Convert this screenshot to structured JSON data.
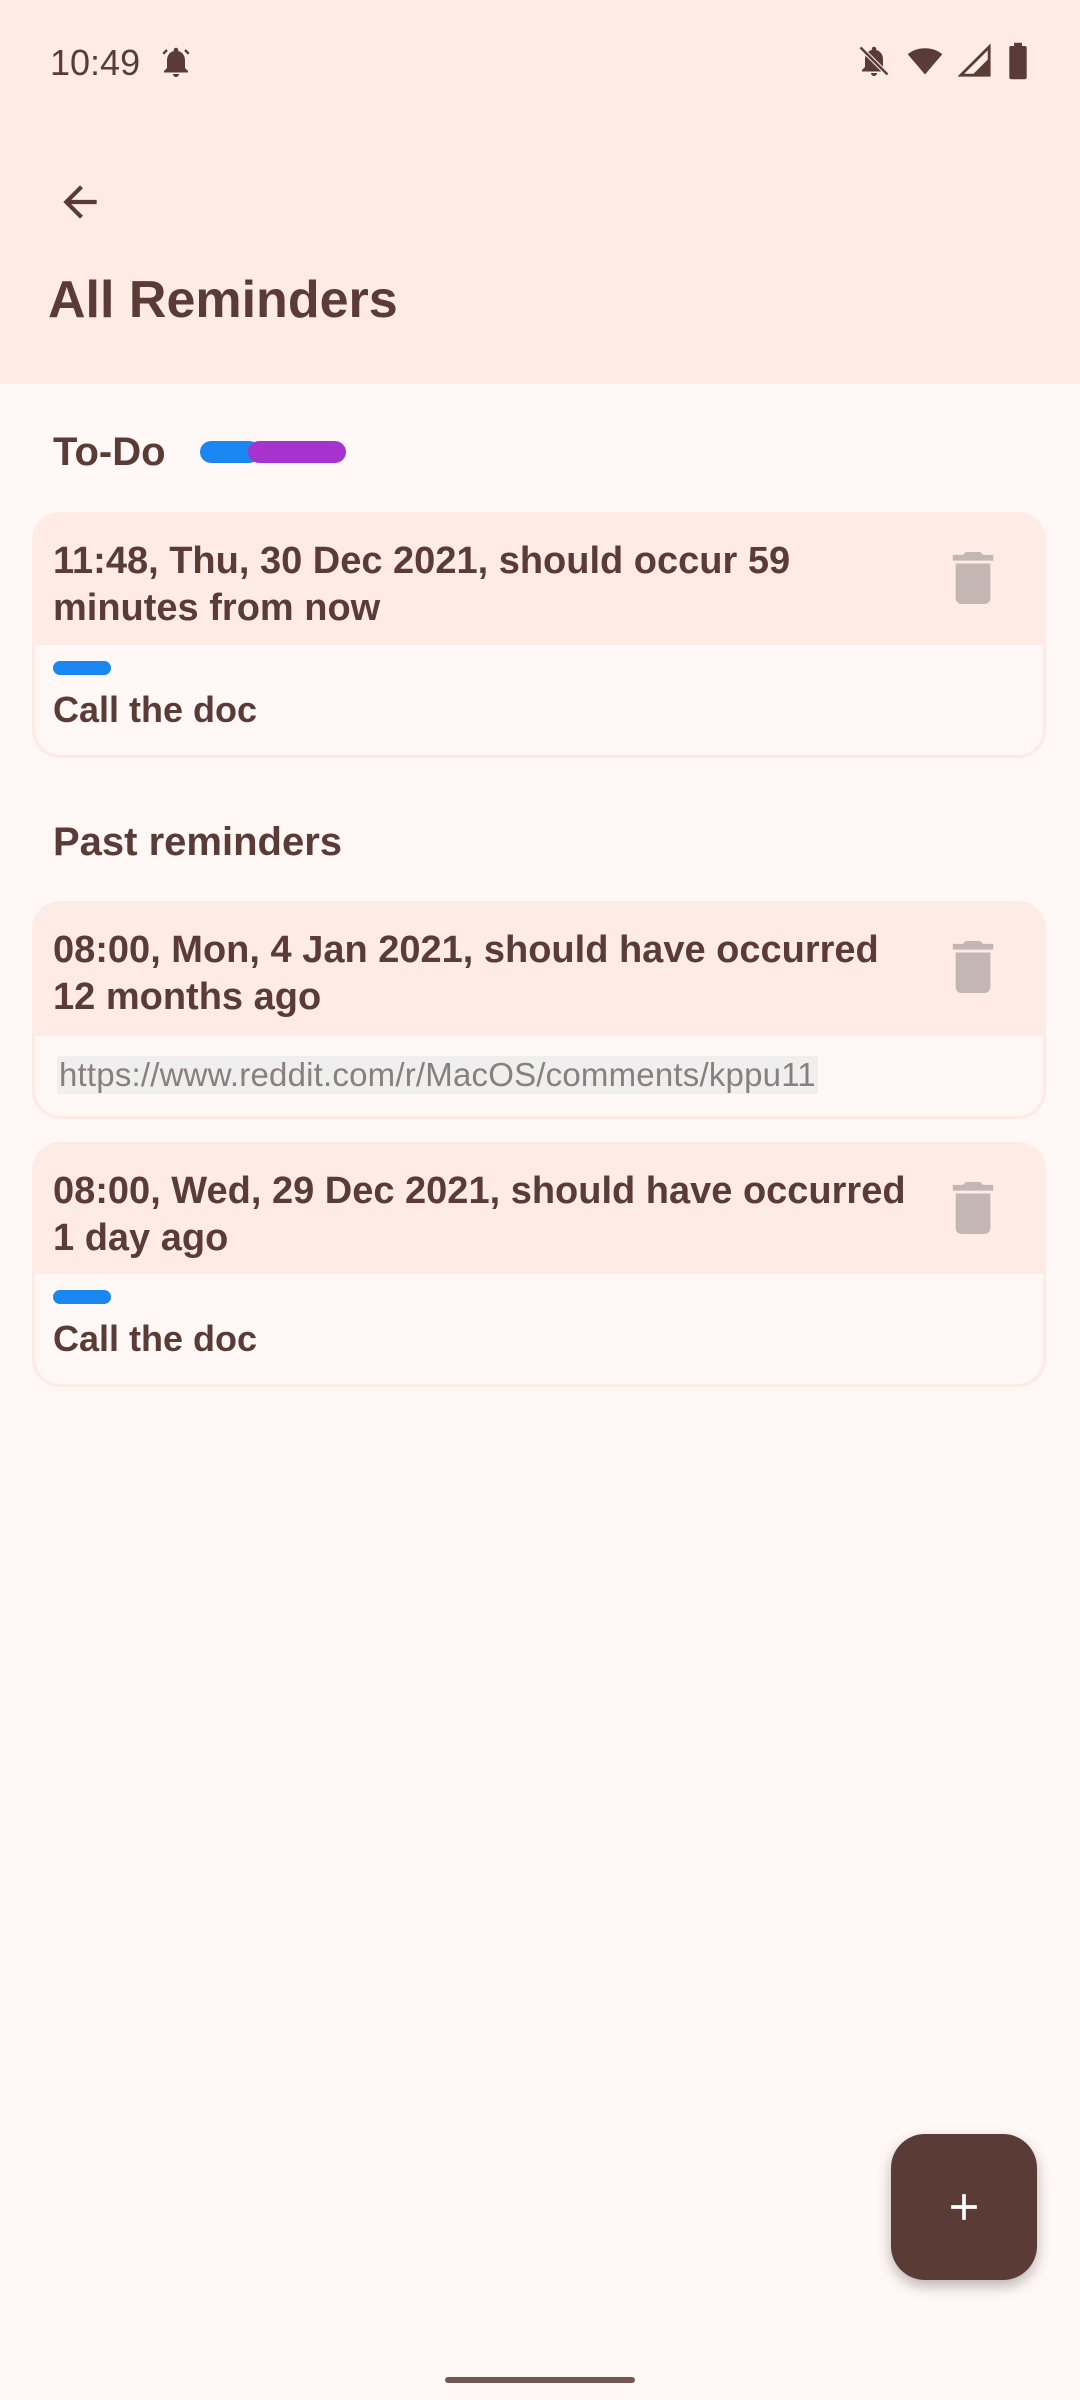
{
  "status_bar": {
    "time": "10:49",
    "icons": [
      "alarm-icon",
      "mute-icon",
      "wifi-icon",
      "signal-icon",
      "battery-icon"
    ]
  },
  "app_bar": {
    "back_icon": "arrow-back-icon",
    "title": "All Reminders"
  },
  "todo": {
    "header": "To-Do",
    "tag_colors": [
      "#1a86f0",
      "#a733cf"
    ],
    "reminders": [
      {
        "title": "11:48, Thu, 30 Dec 2021, should occur 59 minutes from now",
        "note": "Call the doc",
        "tag_color": "#1a86f0"
      }
    ]
  },
  "past": {
    "header": "Past reminders",
    "reminders": [
      {
        "title": "08:00, Mon, 4 Jan 2021, should have occurred 12 months ago",
        "link": "https://www.reddit.com/r/MacOS/comments/kppu11"
      },
      {
        "title": "08:00, Wed, 29 Dec 2021, should have occurred 1 day ago",
        "note": "Call the doc",
        "tag_color": "#1a86f0"
      }
    ]
  },
  "fab": {
    "icon": "plus-icon"
  },
  "colors": {
    "app_bar_bg": "#ffebe6",
    "page_bg": "#fff8f6",
    "text": "#5a3b36",
    "trash_icon": "#c3b6b3"
  }
}
